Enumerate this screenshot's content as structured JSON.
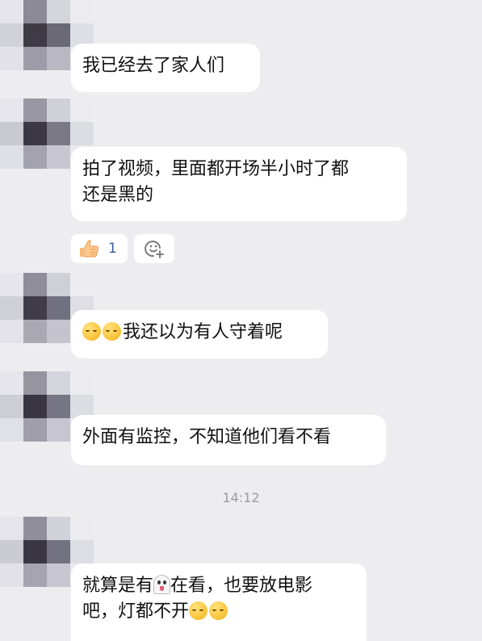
{
  "colors": {
    "background": "#ededf0",
    "bubble": "#ffffff",
    "text": "#111111",
    "timestamp": "#9a9aa0",
    "reaction_count": "#3a5c95"
  },
  "messages": [
    {
      "lines": [
        "我已经去了家人们"
      ]
    },
    {
      "lines": [
        "拍了视频，里面都开场半小时了都",
        "还是黑的"
      ]
    },
    {
      "lines": [
        "我还以为有人守着呢"
      ],
      "leading_emoji": [
        "smiling-emoji",
        "smiling-emoji"
      ]
    },
    {
      "lines": [
        "外面有监控，不知道他们看不看"
      ]
    },
    {
      "line1_before_ghost": "就算是有",
      "ghost_icon": "ghost-emoji",
      "line1_after_ghost": "在看，也要放电影",
      "line2": "吧，灯都不开",
      "trailing_emoji": [
        "smiling-emoji",
        "smiling-emoji"
      ]
    }
  ],
  "reactions": {
    "like_icon": "thumbs-up-icon",
    "like_count": "1",
    "add_icon": "add-emoji-icon"
  },
  "timestamp": "14:12"
}
